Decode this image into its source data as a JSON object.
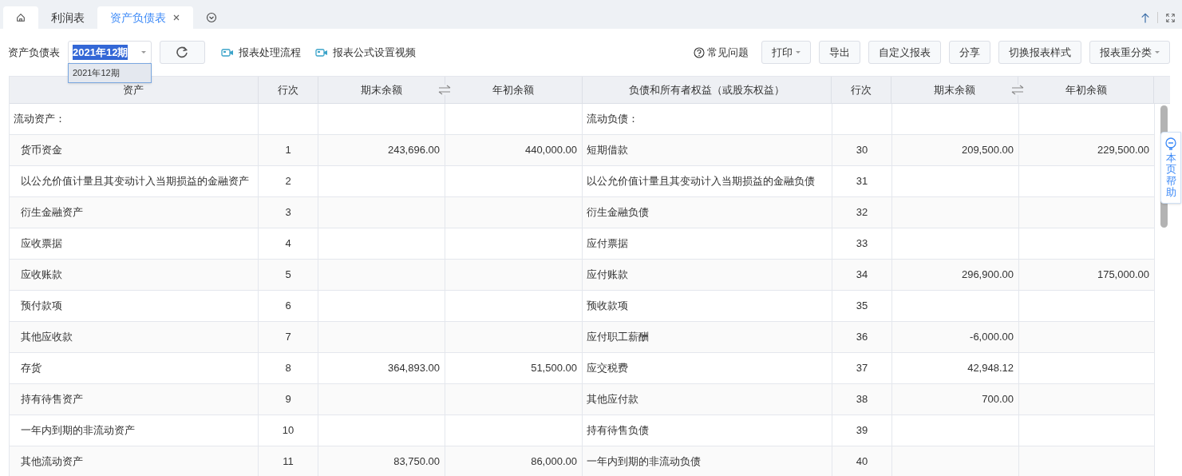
{
  "tabs": [
    {
      "kind": "home",
      "selected": false
    },
    {
      "kind": "text",
      "label": "利润表",
      "selected": false
    },
    {
      "kind": "text",
      "label": "资产负债表",
      "selected": true,
      "closable": true
    },
    {
      "kind": "more",
      "selected": false
    }
  ],
  "toolbar": {
    "report_label": "资产负债表",
    "period": {
      "value": "2021年12期",
      "expanded": true,
      "options": [
        "2021年12期"
      ]
    },
    "video_links": [
      "报表处理流程",
      "报表公式设置视频"
    ],
    "faq": "常见问题",
    "buttons": [
      {
        "label": "打印",
        "dropdown": true
      },
      {
        "label": "导出",
        "dropdown": false
      },
      {
        "label": "自定义报表",
        "dropdown": false
      },
      {
        "label": "分享",
        "dropdown": false
      },
      {
        "label": "切换报表样式",
        "dropdown": false
      },
      {
        "label": "报表重分类",
        "dropdown": true
      }
    ]
  },
  "table": {
    "columns": [
      "资产",
      "行次",
      "期末余额",
      "年初余额",
      "负债和所有者权益（或股东权益）",
      "行次",
      "期末余额",
      "年初余额"
    ],
    "rows": [
      {
        "kind": "section",
        "cells": [
          "流动资产：",
          "",
          "",
          "",
          "流动负债：",
          "",
          "",
          ""
        ]
      },
      {
        "kind": "item",
        "cells": [
          "货币资金",
          "1",
          "243,696.00",
          "440,000.00",
          "短期借款",
          "30",
          "209,500.00",
          "229,500.00"
        ]
      },
      {
        "kind": "item",
        "cells": [
          "以公允价值计量且其变动计入当期损益的金融资产",
          "2",
          "",
          "",
          "以公允价值计量且其变动计入当期损益的金融负债",
          "31",
          "",
          ""
        ]
      },
      {
        "kind": "item",
        "cells": [
          "衍生金融资产",
          "3",
          "",
          "",
          "衍生金融负债",
          "32",
          "",
          ""
        ]
      },
      {
        "kind": "item",
        "cells": [
          "应收票据",
          "4",
          "",
          "",
          "应付票据",
          "33",
          "",
          ""
        ]
      },
      {
        "kind": "item",
        "cells": [
          "应收账款",
          "5",
          "",
          "",
          "应付账款",
          "34",
          "296,900.00",
          "175,000.00"
        ]
      },
      {
        "kind": "item",
        "cells": [
          "预付款项",
          "6",
          "",
          "",
          "预收款项",
          "35",
          "",
          ""
        ]
      },
      {
        "kind": "item",
        "cells": [
          "其他应收款",
          "7",
          "",
          "",
          "应付职工薪酬",
          "36",
          "-6,000.00",
          ""
        ]
      },
      {
        "kind": "item",
        "cells": [
          "存货",
          "8",
          "364,893.00",
          "51,500.00",
          "应交税费",
          "37",
          "42,948.12",
          ""
        ]
      },
      {
        "kind": "item",
        "cells": [
          "持有待售资产",
          "9",
          "",
          "",
          "其他应付款",
          "38",
          "700.00",
          ""
        ]
      },
      {
        "kind": "item",
        "cells": [
          "一年内到期的非流动资产",
          "10",
          "",
          "",
          "持有待售负债",
          "39",
          "",
          ""
        ]
      },
      {
        "kind": "item",
        "cells": [
          "其他流动资产",
          "11",
          "83,750.00",
          "86,000.00",
          "一年内到期的非流动负债",
          "40",
          "",
          ""
        ]
      }
    ]
  },
  "help_tab": "本页帮助"
}
